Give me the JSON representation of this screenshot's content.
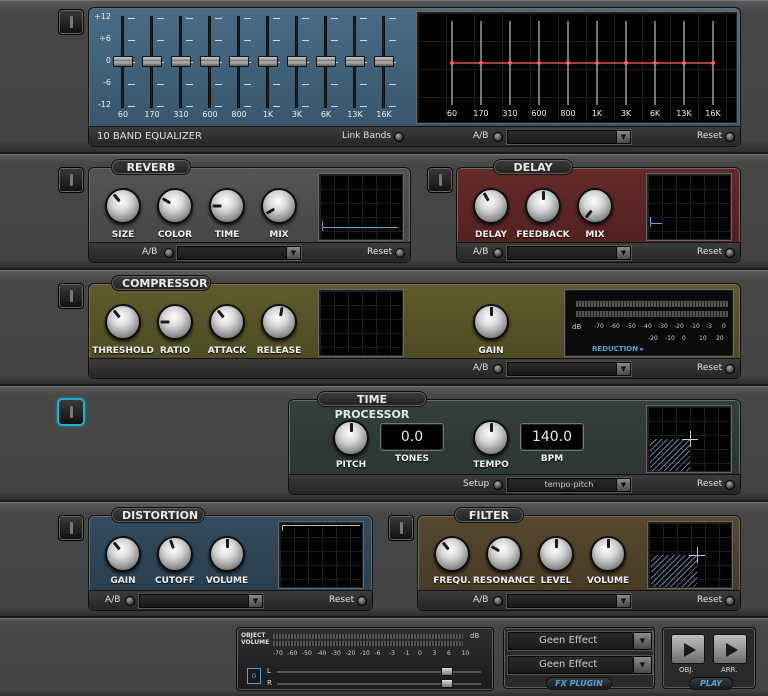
{
  "eq": {
    "title": "10 BAND EQUALIZER",
    "link_bands": "Link Bands",
    "ab": "A/B",
    "reset": "Reset",
    "scale": [
      "+12",
      "+6",
      "0",
      "-6",
      "-12"
    ],
    "bands": [
      "60",
      "170",
      "310",
      "600",
      "800",
      "1K",
      "3K",
      "6K",
      "13K",
      "16K"
    ],
    "gains_db": [
      0,
      0,
      0,
      0,
      0,
      0,
      0,
      0,
      0,
      0
    ],
    "preset": ""
  },
  "reverb": {
    "title": "REVERB",
    "knobs": [
      "SIZE",
      "COLOR",
      "TIME",
      "MIX"
    ],
    "ab": "A/B",
    "reset": "Reset",
    "preset": ""
  },
  "delay": {
    "title": "DELAY",
    "knobs": [
      "DELAY",
      "FEEDBACK",
      "MIX"
    ],
    "ab": "A/B",
    "reset": "Reset",
    "preset": ""
  },
  "compressor": {
    "title": "COMPRESSOR",
    "knobs": [
      "THRESHOLD",
      "RATIO",
      "ATTACK",
      "RELEASE"
    ],
    "gain_label": "GAIN",
    "meter_db": "dB",
    "meter_scale_top": [
      "-70",
      "-60",
      "-50",
      "-40",
      "-30",
      "-20",
      "-10",
      "-3",
      "0"
    ],
    "meter_scale_bottom": [
      "-20",
      "-10",
      "0",
      "10",
      "20"
    ],
    "reduction": "REDUCTION ▸",
    "ab": "A/B",
    "reset": "Reset",
    "preset": ""
  },
  "time_processor": {
    "title": "TIME PROCESSOR",
    "pitch_label": "PITCH",
    "tones_value": "0.0",
    "tones_label": "TONES",
    "tempo_label": "TEMPO",
    "bpm_value": "140.0",
    "bpm_label": "BPM",
    "setup_label": "Setup",
    "setup_value": "tempo-pitch",
    "reset": "Reset"
  },
  "distortion": {
    "title": "DISTORTION",
    "knobs": [
      "GAIN",
      "CUTOFF",
      "VOLUME"
    ],
    "ab": "A/B",
    "reset": "Reset",
    "preset": ""
  },
  "filter": {
    "title": "FILTER",
    "knobs": [
      "FREQU.",
      "RESONANCE",
      "LEVEL",
      "VOLUME"
    ],
    "ab": "A/B",
    "reset": "Reset",
    "preset": ""
  },
  "master": {
    "object_volume": "OBJECT\nVOLUME",
    "db": "dB",
    "scale": [
      "-70",
      "-60",
      "-50",
      "-40",
      "-30",
      "-20",
      "-10",
      "-6",
      "-3",
      "-1",
      "0",
      "3",
      "6",
      "10"
    ],
    "left": "L",
    "right": "R",
    "link": "0",
    "effect1": "Geen Effect",
    "effect2": "Geen Effect",
    "fx_plugin": "FX PLUGIN",
    "obj_label": "OBJ.",
    "arr_label": "ARR.",
    "play_label": "PLAY"
  },
  "colors": {
    "eq": "#3f5c74",
    "reverb": "#4a4a4a",
    "delay": "#5a2424",
    "compressor": "#575428",
    "time_processor": "#2f3a3a",
    "distortion": "#2e4456",
    "filter": "#4e4128",
    "accent": "#19b4c8"
  }
}
